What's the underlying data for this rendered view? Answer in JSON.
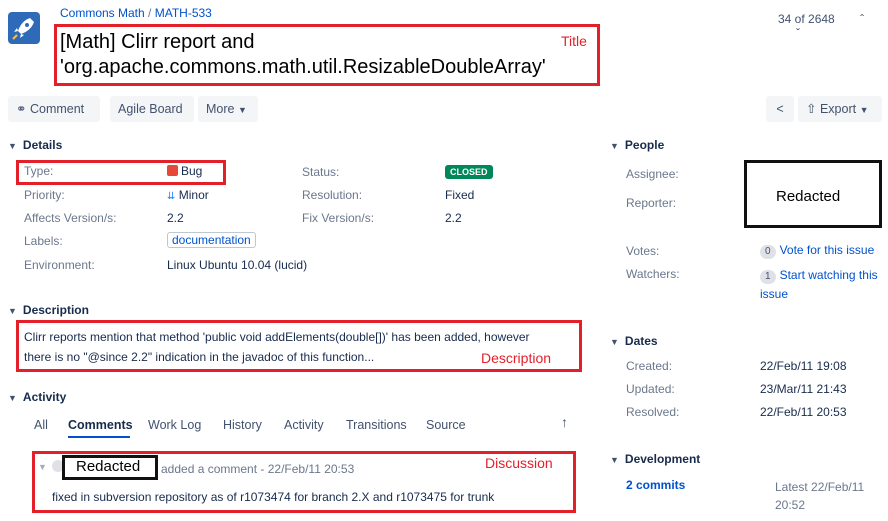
{
  "header": {
    "project": "Commons Math",
    "separator": "/",
    "issue_key": "MATH-533",
    "title_line1": "[Math] Clirr report and",
    "title_line2": "'org.apache.commons.math.util.ResizableDoubleArray'",
    "pager": "34 of 2648"
  },
  "toolbar": {
    "comment": "Comment",
    "agile_board": "Agile Board",
    "more": "More",
    "export": "Export"
  },
  "details": {
    "heading": "Details",
    "type_label": "Type:",
    "type_value": "Bug",
    "priority_label": "Priority:",
    "priority_value": "Minor",
    "affects_label": "Affects Version/s:",
    "affects_value": "2.2",
    "labels_label": "Labels:",
    "labels_value": "documentation",
    "environment_label": "Environment:",
    "environment_value": "Linux Ubuntu 10.04 (lucid)",
    "status_label": "Status:",
    "status_value": "CLOSED",
    "resolution_label": "Resolution:",
    "resolution_value": "Fixed",
    "fix_label": "Fix Version/s:",
    "fix_value": "2.2"
  },
  "description": {
    "heading": "Description",
    "line1": "Clirr reports mention that method 'public void addElements(double[])' has been added, however",
    "line2": "there is no \"@since 2.2\" indication in the javadoc of this function..."
  },
  "activity": {
    "heading": "Activity",
    "tabs": [
      "All",
      "Comments",
      "Work Log",
      "History",
      "Activity",
      "Transitions",
      "Source"
    ],
    "comment_author": "Redacted",
    "comment_meta": "added a comment - 22/Feb/11 20:53",
    "comment_body": "fixed in subversion repository as of r1073474 for branch 2.X and r1073475 for trunk"
  },
  "people": {
    "heading": "People",
    "assignee_label": "Assignee:",
    "reporter_label": "Reporter:",
    "redacted": "Redacted",
    "votes_label": "Votes:",
    "votes_count": "0",
    "votes_link": "Vote for this issue",
    "watchers_label": "Watchers:",
    "watchers_count": "1",
    "watchers_link_1": "Start watching this",
    "watchers_link_2": "issue"
  },
  "dates": {
    "heading": "Dates",
    "created_label": "Created:",
    "created_value": "22/Feb/11 19:08",
    "updated_label": "Updated:",
    "updated_value": "23/Mar/11 21:43",
    "resolved_label": "Resolved:",
    "resolved_value": "22/Feb/11 20:53"
  },
  "development": {
    "heading": "Development",
    "commits": "2 commits",
    "latest_1": "Latest 22/Feb/11",
    "latest_2": "20:52"
  },
  "annotations": {
    "title": "Title",
    "description": "Description",
    "discussion": "Discussion"
  },
  "colors": {
    "annotation_red": "#e3202a",
    "link_blue": "#0052cc",
    "closed_green": "#00875a",
    "bug_red": "#e5493a"
  }
}
